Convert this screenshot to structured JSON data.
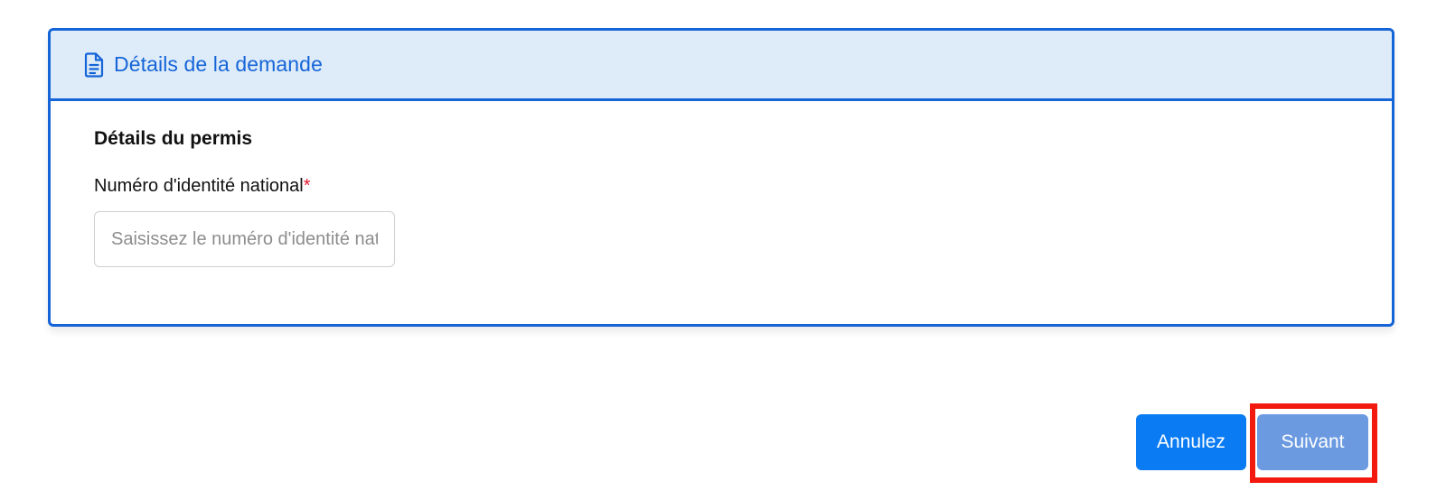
{
  "card": {
    "header_title": "Détails de la demande",
    "header_icon": "document-icon",
    "accent_color": "#1565d8",
    "header_bg": "#deebf8"
  },
  "form": {
    "section_title": "Détails du permis",
    "national_id": {
      "label": "Numéro d'identité national",
      "required_marker": "*",
      "placeholder": "Saisissez le numéro d'identité national",
      "value": ""
    }
  },
  "actions": {
    "cancel_label": "Annulez",
    "next_label": "Suivant",
    "cancel_color": "#0a7bf2",
    "next_color": "#6b9ae1",
    "highlight_color": "#f21a0e"
  }
}
